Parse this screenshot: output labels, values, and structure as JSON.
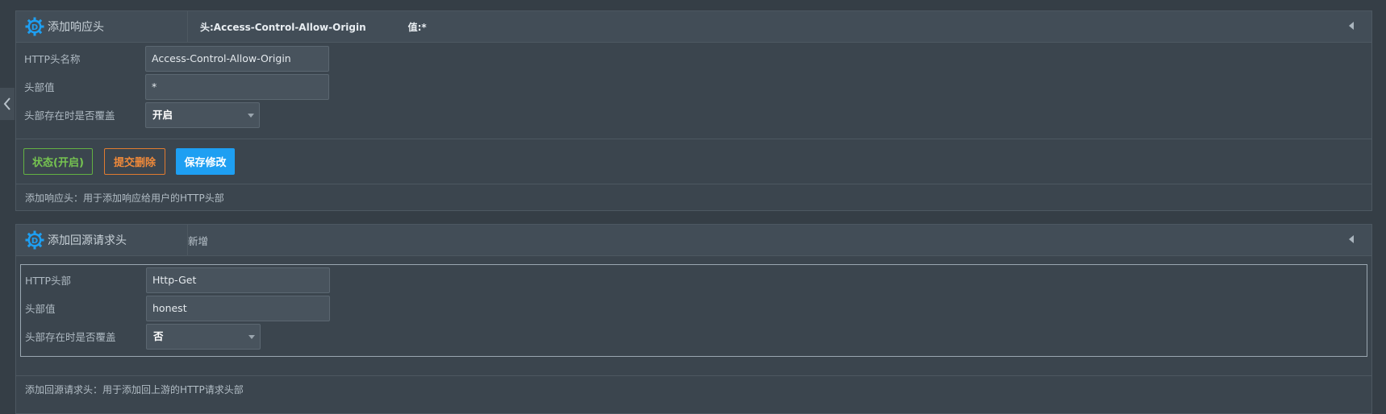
{
  "panels": [
    {
      "title": "添加响应头",
      "head_key": "头:Access-Control-Allow-Origin",
      "head_value": "值:*",
      "fields": [
        {
          "label": "HTTP头名称",
          "value": "Access-Control-Allow-Origin"
        },
        {
          "label": "头部值",
          "value": "*"
        },
        {
          "label": "头部存在时是否覆盖",
          "value": "开启"
        }
      ],
      "buttons": {
        "status": "状态(开启)",
        "delete": "提交删除",
        "save": "保存修改"
      },
      "description": "添加响应头：用于添加响应给用户的HTTP头部"
    },
    {
      "title": "添加回源请求头",
      "head_new": "新增",
      "fields": [
        {
          "label": "HTTP头部",
          "value": "Http-Get"
        },
        {
          "label": "头部值",
          "value": "honest"
        },
        {
          "label": "头部存在时是否覆盖",
          "value": "否"
        }
      ],
      "description": "添加回源请求头：用于添加回上游的HTTP请求头部"
    }
  ],
  "icons": {
    "panel_icon": "gear-d-icon",
    "collapse": "chevron-left-icon",
    "toggle": "triangle-left-icon",
    "select_caret": "caret-down-icon"
  },
  "colors": {
    "accent": "#1e9ff2",
    "status_green": "#76c451",
    "delete_orange": "#f08a3a",
    "background": "#353e46"
  }
}
